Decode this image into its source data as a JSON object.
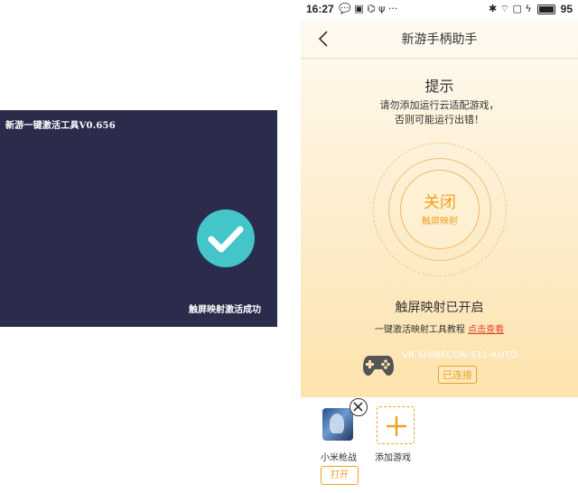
{
  "left_panel": {
    "title": "新游一键激活工具V0.656",
    "status": "触屏映射激活成功",
    "check_color": "#43c5c9",
    "bg_color": "#2b2b4c"
  },
  "statusbar": {
    "time": "16:27",
    "left_icons": "💬 ▣ ⌬ ψ ···",
    "right_icons": "✱ ⌔ ▢ ϟ",
    "battery": "95"
  },
  "app": {
    "title": "新游手柄助手",
    "tip": {
      "title": "提示",
      "line1": "请勿添加运行云适配游戏，",
      "line2": "否则可能运行出错！"
    },
    "toggle": {
      "main": "关闭",
      "sub": "触屏映射"
    },
    "mapping_status": "触屏映射已开启",
    "tutorial_prefix": "一键激活映射工具教程",
    "tutorial_link": "点击查看",
    "device": {
      "name": "VR SHINECON-S11-AUTO",
      "status": "已连接"
    },
    "games": [
      {
        "name": "小米枪战",
        "action": "打开"
      }
    ],
    "add_game_label": "添加游戏",
    "accent_color": "#f0a020"
  }
}
